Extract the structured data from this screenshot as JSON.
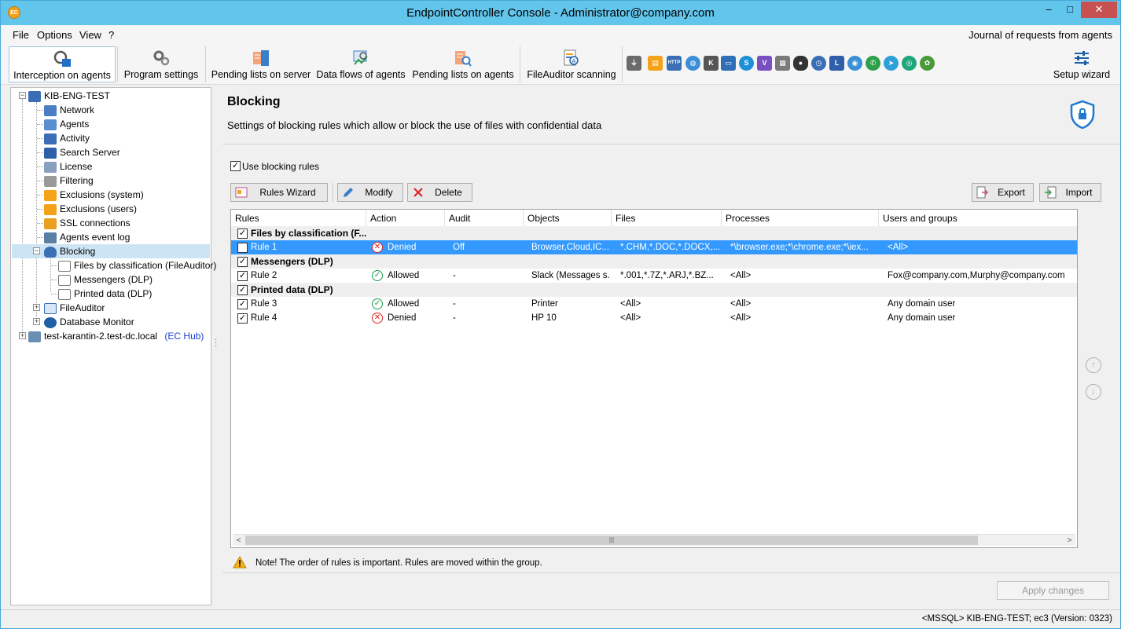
{
  "window": {
    "title": "EndpointController Console - Administrator@company.com",
    "app_icon_text": "EC",
    "min": "–",
    "max": "□",
    "close": "✕"
  },
  "menu": {
    "items": [
      "File",
      "Options",
      "View",
      "?"
    ],
    "journal": "Journal of requests from agents"
  },
  "toolbar": {
    "buttons": [
      {
        "label": "Interception on agents",
        "icon": "gear-monitor-icon"
      },
      {
        "label": "Program settings",
        "icon": "gears-icon"
      },
      {
        "label": "Pending lists on server",
        "icon": "list-server-icon"
      },
      {
        "label": "Data flows of agents",
        "icon": "data-flow-icon"
      },
      {
        "label": "Pending lists on agents",
        "icon": "list-search-icon"
      },
      {
        "label": "FileAuditor scanning",
        "icon": "file-scan-icon"
      }
    ],
    "setup_wizard": "Setup wizard"
  },
  "tree": {
    "root": "KIB-ENG-TEST",
    "items": [
      "Network",
      "Agents",
      "Activity",
      "Search Server",
      "License",
      "Filtering",
      "Exclusions (system)",
      "Exclusions (users)",
      "SSL connections",
      "Agents event log",
      "Blocking",
      "Files by classification (FileAuditor)",
      "Messengers (DLP)",
      "Printed data (DLP)",
      "FileAuditor",
      "Database Monitor"
    ],
    "hub_node": "test-karantin-2.test-dc.local",
    "hub_tag": "(EC Hub)"
  },
  "content": {
    "title": "Blocking",
    "subtitle": "Settings of blocking rules which allow or block the use of files with confidential data",
    "use_rules_label": "Use blocking rules",
    "buttons": {
      "wizard": "Rules Wizard",
      "modify": "Modify",
      "delete": "Delete",
      "export": "Export",
      "import": "Import"
    },
    "columns": [
      "Rules",
      "Action",
      "Audit",
      "Objects",
      "Files",
      "Processes",
      "Users and groups"
    ],
    "groups": [
      {
        "name": "Files by classification (F...",
        "rules": [
          {
            "name": "Rule 1",
            "action": "Denied",
            "audit": "Off",
            "objects": "Browser,Cloud,IC...",
            "files": "*.CHM,*.DOC,*.DOCX,...",
            "processes": "*\\browser.exe;*\\chrome.exe;*\\iex...",
            "users": "<All>"
          }
        ]
      },
      {
        "name": "Messengers (DLP)",
        "rules": [
          {
            "name": "Rule 2",
            "action": "Allowed",
            "audit": "-",
            "objects": "Slack (Messages s...",
            "files": "*.001,*.7Z,*.ARJ,*.BZ...",
            "processes": "<All>",
            "users": "Fox@company.com,Murphy@company.com"
          }
        ]
      },
      {
        "name": "Printed data (DLP)",
        "rules": [
          {
            "name": "Rule 3",
            "action": "Allowed",
            "audit": "-",
            "objects": "Printer",
            "files": "<All>",
            "processes": "<All>",
            "users": "Any domain user"
          },
          {
            "name": "Rule 4",
            "action": "Denied",
            "audit": "-",
            "objects": "HP 10",
            "files": "<All>",
            "processes": "<All>",
            "users": "Any domain user"
          }
        ]
      }
    ],
    "note": "Note! The order of rules is important. Rules are moved within the group.",
    "apply": "Apply changes",
    "scroll_center": "|||"
  },
  "status": {
    "text": "<MSSQL> KIB-ENG-TEST; ec3 (Version: 0323)"
  },
  "colors": {
    "titlebar": "#62c5ec",
    "selection": "#3399ff",
    "denied": "#e02020",
    "allowed": "#1a9e4a"
  }
}
